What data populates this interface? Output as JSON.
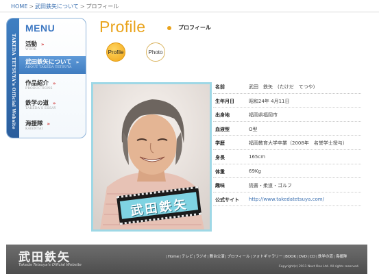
{
  "breadcrumb": {
    "home": "HOME",
    "separator1": ">",
    "section": "武田鉄矢について",
    "separator2": ">",
    "current": "プロフィール"
  },
  "sidebar": {
    "vertical_text": "TAKEDA TETSUYA's Official Website",
    "menu_title": "MENU",
    "arrow": "»",
    "items": [
      {
        "label": "活動",
        "sub": "WORK",
        "active": false
      },
      {
        "label": "武田鉄矢について",
        "sub": "ABOUT TAKEDA TETSUYA",
        "active": true
      },
      {
        "label": "作品紹介",
        "sub": "PRODUCTIONS",
        "active": false
      },
      {
        "label": "鉄学の道",
        "sub": "TAKEDA'S ESSAY",
        "active": false
      },
      {
        "label": "海援隊",
        "sub": "KAIENTAI",
        "active": false
      }
    ]
  },
  "content": {
    "heading": "Profile",
    "heading_sub": "プロフィール",
    "tabs": [
      {
        "label": "Profile",
        "selected": true
      },
      {
        "label": "Photo",
        "selected": false
      }
    ],
    "photo_caption": "武田鉄矢"
  },
  "profile": [
    {
      "label": "名前",
      "value": "武田　鉄矢　(たけだ　てつや)"
    },
    {
      "label": "生年月日",
      "value": "昭和24年 4月11日"
    },
    {
      "label": "出身地",
      "value": "福岡県福岡市"
    },
    {
      "label": "血液型",
      "value": "O型"
    },
    {
      "label": "学歴",
      "value": "福岡教育大学卒業（2008年　名誉学士授与）"
    },
    {
      "label": "身長",
      "value": "165cm"
    },
    {
      "label": "体重",
      "value": "69Kg"
    },
    {
      "label": "趣味",
      "value": "読書・柔道・ゴルフ"
    },
    {
      "label": "公式サイト",
      "value": "http://www.takedatetsuya.com/"
    }
  ],
  "footer": {
    "logo": "武田鉄矢",
    "tagline": "Takeda Tetsuya's Official Website",
    "links": [
      "Home",
      "テレビ",
      "ラジオ",
      "舞台公演",
      "プロフィール",
      "フォトギャラリー",
      "BOOK",
      "DVD",
      "CD",
      "鉄学の道",
      "海援隊"
    ],
    "link_separator": "|",
    "copyright": "Copyright(c) 2011 Next One Ltd. All rights reserved."
  },
  "colors": {
    "accent_orange": "#e9a31b",
    "sidebar_blue": "#3d78c2",
    "photo_border": "#9ed8e6",
    "footer_bg": "#5a5a5a"
  }
}
